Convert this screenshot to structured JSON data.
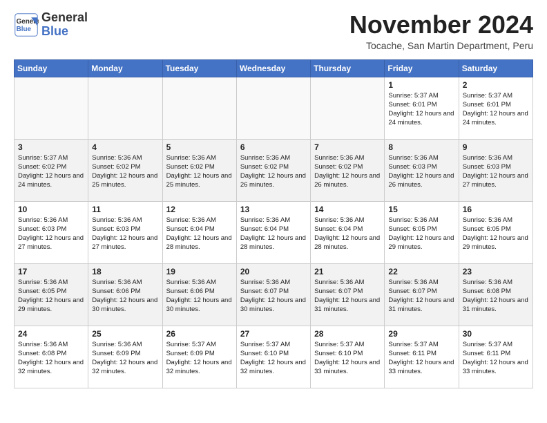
{
  "header": {
    "logo_line1": "General",
    "logo_line2": "Blue",
    "title": "November 2024",
    "location": "Tocache, San Martin Department, Peru"
  },
  "days_of_week": [
    "Sunday",
    "Monday",
    "Tuesday",
    "Wednesday",
    "Thursday",
    "Friday",
    "Saturday"
  ],
  "weeks": [
    [
      {
        "day": "",
        "info": ""
      },
      {
        "day": "",
        "info": ""
      },
      {
        "day": "",
        "info": ""
      },
      {
        "day": "",
        "info": ""
      },
      {
        "day": "",
        "info": ""
      },
      {
        "day": "1",
        "info": "Sunrise: 5:37 AM\nSunset: 6:01 PM\nDaylight: 12 hours and 24 minutes."
      },
      {
        "day": "2",
        "info": "Sunrise: 5:37 AM\nSunset: 6:01 PM\nDaylight: 12 hours and 24 minutes."
      }
    ],
    [
      {
        "day": "3",
        "info": "Sunrise: 5:37 AM\nSunset: 6:02 PM\nDaylight: 12 hours and 24 minutes."
      },
      {
        "day": "4",
        "info": "Sunrise: 5:36 AM\nSunset: 6:02 PM\nDaylight: 12 hours and 25 minutes."
      },
      {
        "day": "5",
        "info": "Sunrise: 5:36 AM\nSunset: 6:02 PM\nDaylight: 12 hours and 25 minutes."
      },
      {
        "day": "6",
        "info": "Sunrise: 5:36 AM\nSunset: 6:02 PM\nDaylight: 12 hours and 26 minutes."
      },
      {
        "day": "7",
        "info": "Sunrise: 5:36 AM\nSunset: 6:02 PM\nDaylight: 12 hours and 26 minutes."
      },
      {
        "day": "8",
        "info": "Sunrise: 5:36 AM\nSunset: 6:03 PM\nDaylight: 12 hours and 26 minutes."
      },
      {
        "day": "9",
        "info": "Sunrise: 5:36 AM\nSunset: 6:03 PM\nDaylight: 12 hours and 27 minutes."
      }
    ],
    [
      {
        "day": "10",
        "info": "Sunrise: 5:36 AM\nSunset: 6:03 PM\nDaylight: 12 hours and 27 minutes."
      },
      {
        "day": "11",
        "info": "Sunrise: 5:36 AM\nSunset: 6:03 PM\nDaylight: 12 hours and 27 minutes."
      },
      {
        "day": "12",
        "info": "Sunrise: 5:36 AM\nSunset: 6:04 PM\nDaylight: 12 hours and 28 minutes."
      },
      {
        "day": "13",
        "info": "Sunrise: 5:36 AM\nSunset: 6:04 PM\nDaylight: 12 hours and 28 minutes."
      },
      {
        "day": "14",
        "info": "Sunrise: 5:36 AM\nSunset: 6:04 PM\nDaylight: 12 hours and 28 minutes."
      },
      {
        "day": "15",
        "info": "Sunrise: 5:36 AM\nSunset: 6:05 PM\nDaylight: 12 hours and 29 minutes."
      },
      {
        "day": "16",
        "info": "Sunrise: 5:36 AM\nSunset: 6:05 PM\nDaylight: 12 hours and 29 minutes."
      }
    ],
    [
      {
        "day": "17",
        "info": "Sunrise: 5:36 AM\nSunset: 6:05 PM\nDaylight: 12 hours and 29 minutes."
      },
      {
        "day": "18",
        "info": "Sunrise: 5:36 AM\nSunset: 6:06 PM\nDaylight: 12 hours and 30 minutes."
      },
      {
        "day": "19",
        "info": "Sunrise: 5:36 AM\nSunset: 6:06 PM\nDaylight: 12 hours and 30 minutes."
      },
      {
        "day": "20",
        "info": "Sunrise: 5:36 AM\nSunset: 6:07 PM\nDaylight: 12 hours and 30 minutes."
      },
      {
        "day": "21",
        "info": "Sunrise: 5:36 AM\nSunset: 6:07 PM\nDaylight: 12 hours and 31 minutes."
      },
      {
        "day": "22",
        "info": "Sunrise: 5:36 AM\nSunset: 6:07 PM\nDaylight: 12 hours and 31 minutes."
      },
      {
        "day": "23",
        "info": "Sunrise: 5:36 AM\nSunset: 6:08 PM\nDaylight: 12 hours and 31 minutes."
      }
    ],
    [
      {
        "day": "24",
        "info": "Sunrise: 5:36 AM\nSunset: 6:08 PM\nDaylight: 12 hours and 32 minutes."
      },
      {
        "day": "25",
        "info": "Sunrise: 5:36 AM\nSunset: 6:09 PM\nDaylight: 12 hours and 32 minutes."
      },
      {
        "day": "26",
        "info": "Sunrise: 5:37 AM\nSunset: 6:09 PM\nDaylight: 12 hours and 32 minutes."
      },
      {
        "day": "27",
        "info": "Sunrise: 5:37 AM\nSunset: 6:10 PM\nDaylight: 12 hours and 32 minutes."
      },
      {
        "day": "28",
        "info": "Sunrise: 5:37 AM\nSunset: 6:10 PM\nDaylight: 12 hours and 33 minutes."
      },
      {
        "day": "29",
        "info": "Sunrise: 5:37 AM\nSunset: 6:11 PM\nDaylight: 12 hours and 33 minutes."
      },
      {
        "day": "30",
        "info": "Sunrise: 5:37 AM\nSunset: 6:11 PM\nDaylight: 12 hours and 33 minutes."
      }
    ]
  ]
}
